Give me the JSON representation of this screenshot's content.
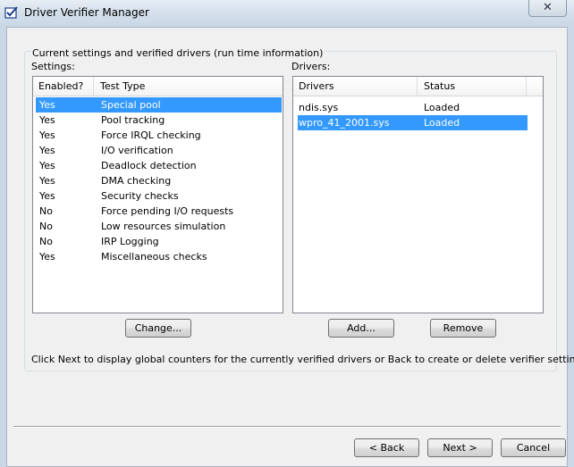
{
  "window": {
    "title": "Driver Verifier Manager",
    "close_glyph": "✕"
  },
  "group_caption": "Current settings and verified drivers (run time information)",
  "settings": {
    "label": "Settings:",
    "columns": [
      "Enabled?",
      "Test Type"
    ],
    "rows": [
      {
        "enabled": "Yes",
        "test": "Special pool",
        "selected": true
      },
      {
        "enabled": "Yes",
        "test": "Pool tracking"
      },
      {
        "enabled": "Yes",
        "test": "Force IRQL checking"
      },
      {
        "enabled": "Yes",
        "test": "I/O verification"
      },
      {
        "enabled": "Yes",
        "test": "Deadlock detection"
      },
      {
        "enabled": "Yes",
        "test": "DMA checking"
      },
      {
        "enabled": "Yes",
        "test": "Security checks"
      },
      {
        "enabled": "No",
        "test": "Force pending I/O requests"
      },
      {
        "enabled": "No",
        "test": "Low resources simulation"
      },
      {
        "enabled": "No",
        "test": "IRP Logging"
      },
      {
        "enabled": "Yes",
        "test": "Miscellaneous checks"
      }
    ],
    "change_label": "Change..."
  },
  "drivers": {
    "label": "Drivers:",
    "columns": [
      "Drivers",
      "Status"
    ],
    "rows": [
      {
        "name": "ndis.sys",
        "status": "Loaded"
      },
      {
        "name": "wpro_41_2001.sys",
        "status": "Loaded",
        "selected": true
      }
    ],
    "add_label": "Add...",
    "remove_label": "Remove"
  },
  "info_text": "Click Next to display global counters for the currently verified drivers or Back to create or delete verifier settings.",
  "footer": {
    "back_label": "< Back",
    "next_label": "Next >",
    "cancel_label": "Cancel"
  },
  "colors": {
    "selection": "#3399ff",
    "dialog_bg": "#f0f0f0",
    "frame": "#c9d7e6"
  },
  "icons": {
    "app": "checkmark-doc-icon",
    "close": "close-icon"
  }
}
